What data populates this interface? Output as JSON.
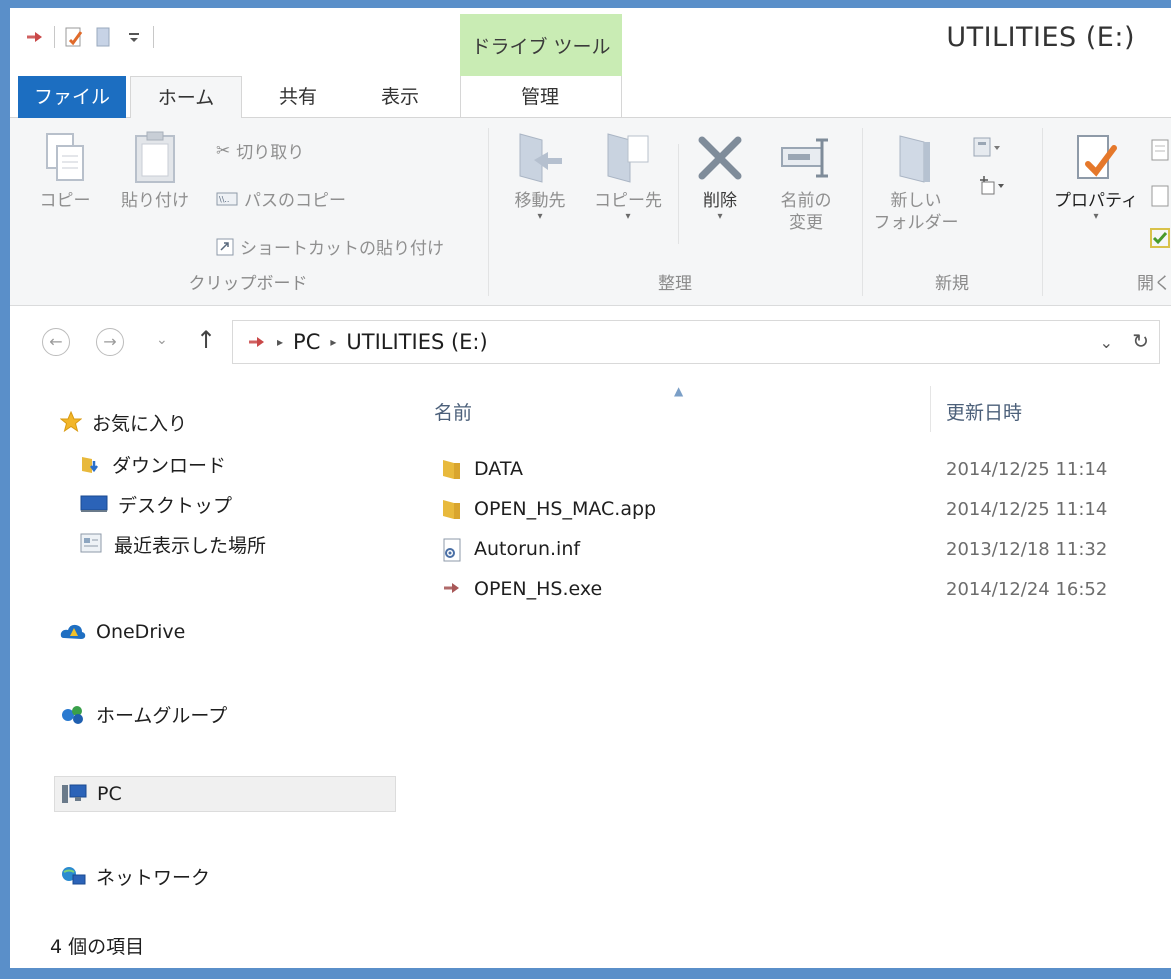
{
  "window": {
    "title": "UTILITIES (E:)",
    "context_tab_group": "ドライブ ツール"
  },
  "tabs": {
    "file": "ファイル",
    "home": "ホーム",
    "share": "共有",
    "view": "表示",
    "manage": "管理"
  },
  "ribbon": {
    "clipboard": {
      "copy": "コピー",
      "paste": "貼り付け",
      "cut": "切り取り",
      "copy_path": "パスのコピー",
      "paste_shortcut": "ショートカットの貼り付け",
      "group_label": "クリップボード"
    },
    "organize": {
      "move_to": "移動先",
      "copy_to": "コピー先",
      "delete": "削除",
      "rename_line1": "名前の",
      "rename_line2": "変更",
      "group_label": "整理"
    },
    "new": {
      "new_folder_line1": "新しい",
      "new_folder_line2": "フォルダー",
      "group_label": "新規"
    },
    "open": {
      "properties": "プロパティ",
      "group_label": "開く"
    }
  },
  "address": {
    "crumbs": [
      "PC",
      "UTILITIES (E:)"
    ]
  },
  "nav_pane": {
    "favorites": "お気に入り",
    "downloads": "ダウンロード",
    "desktop": "デスクトップ",
    "recent": "最近表示した場所",
    "onedrive": "OneDrive",
    "homegroup": "ホームグループ",
    "pc": "PC",
    "network": "ネットワーク"
  },
  "file_list": {
    "columns": {
      "name": "名前",
      "modified": "更新日時"
    },
    "rows": [
      {
        "name": "DATA",
        "modified": "2014/12/25 11:14",
        "type_icon": "folder-icon"
      },
      {
        "name": "OPEN_HS_MAC.app",
        "modified": "2014/12/25 11:14",
        "type_icon": "folder-icon"
      },
      {
        "name": "Autorun.inf",
        "modified": "2013/12/18 11:32",
        "type_icon": "settings-file-icon"
      },
      {
        "name": "OPEN_HS.exe",
        "modified": "2014/12/24 16:52",
        "type_icon": "exe-arrow-icon"
      }
    ]
  },
  "status": {
    "item_count": "4 個の項目"
  },
  "colors": {
    "file_tab": "#1c6ec1",
    "context_tab": "#c9ecb4",
    "folder": "#e8b93c",
    "frame": "#5a8fc9"
  }
}
